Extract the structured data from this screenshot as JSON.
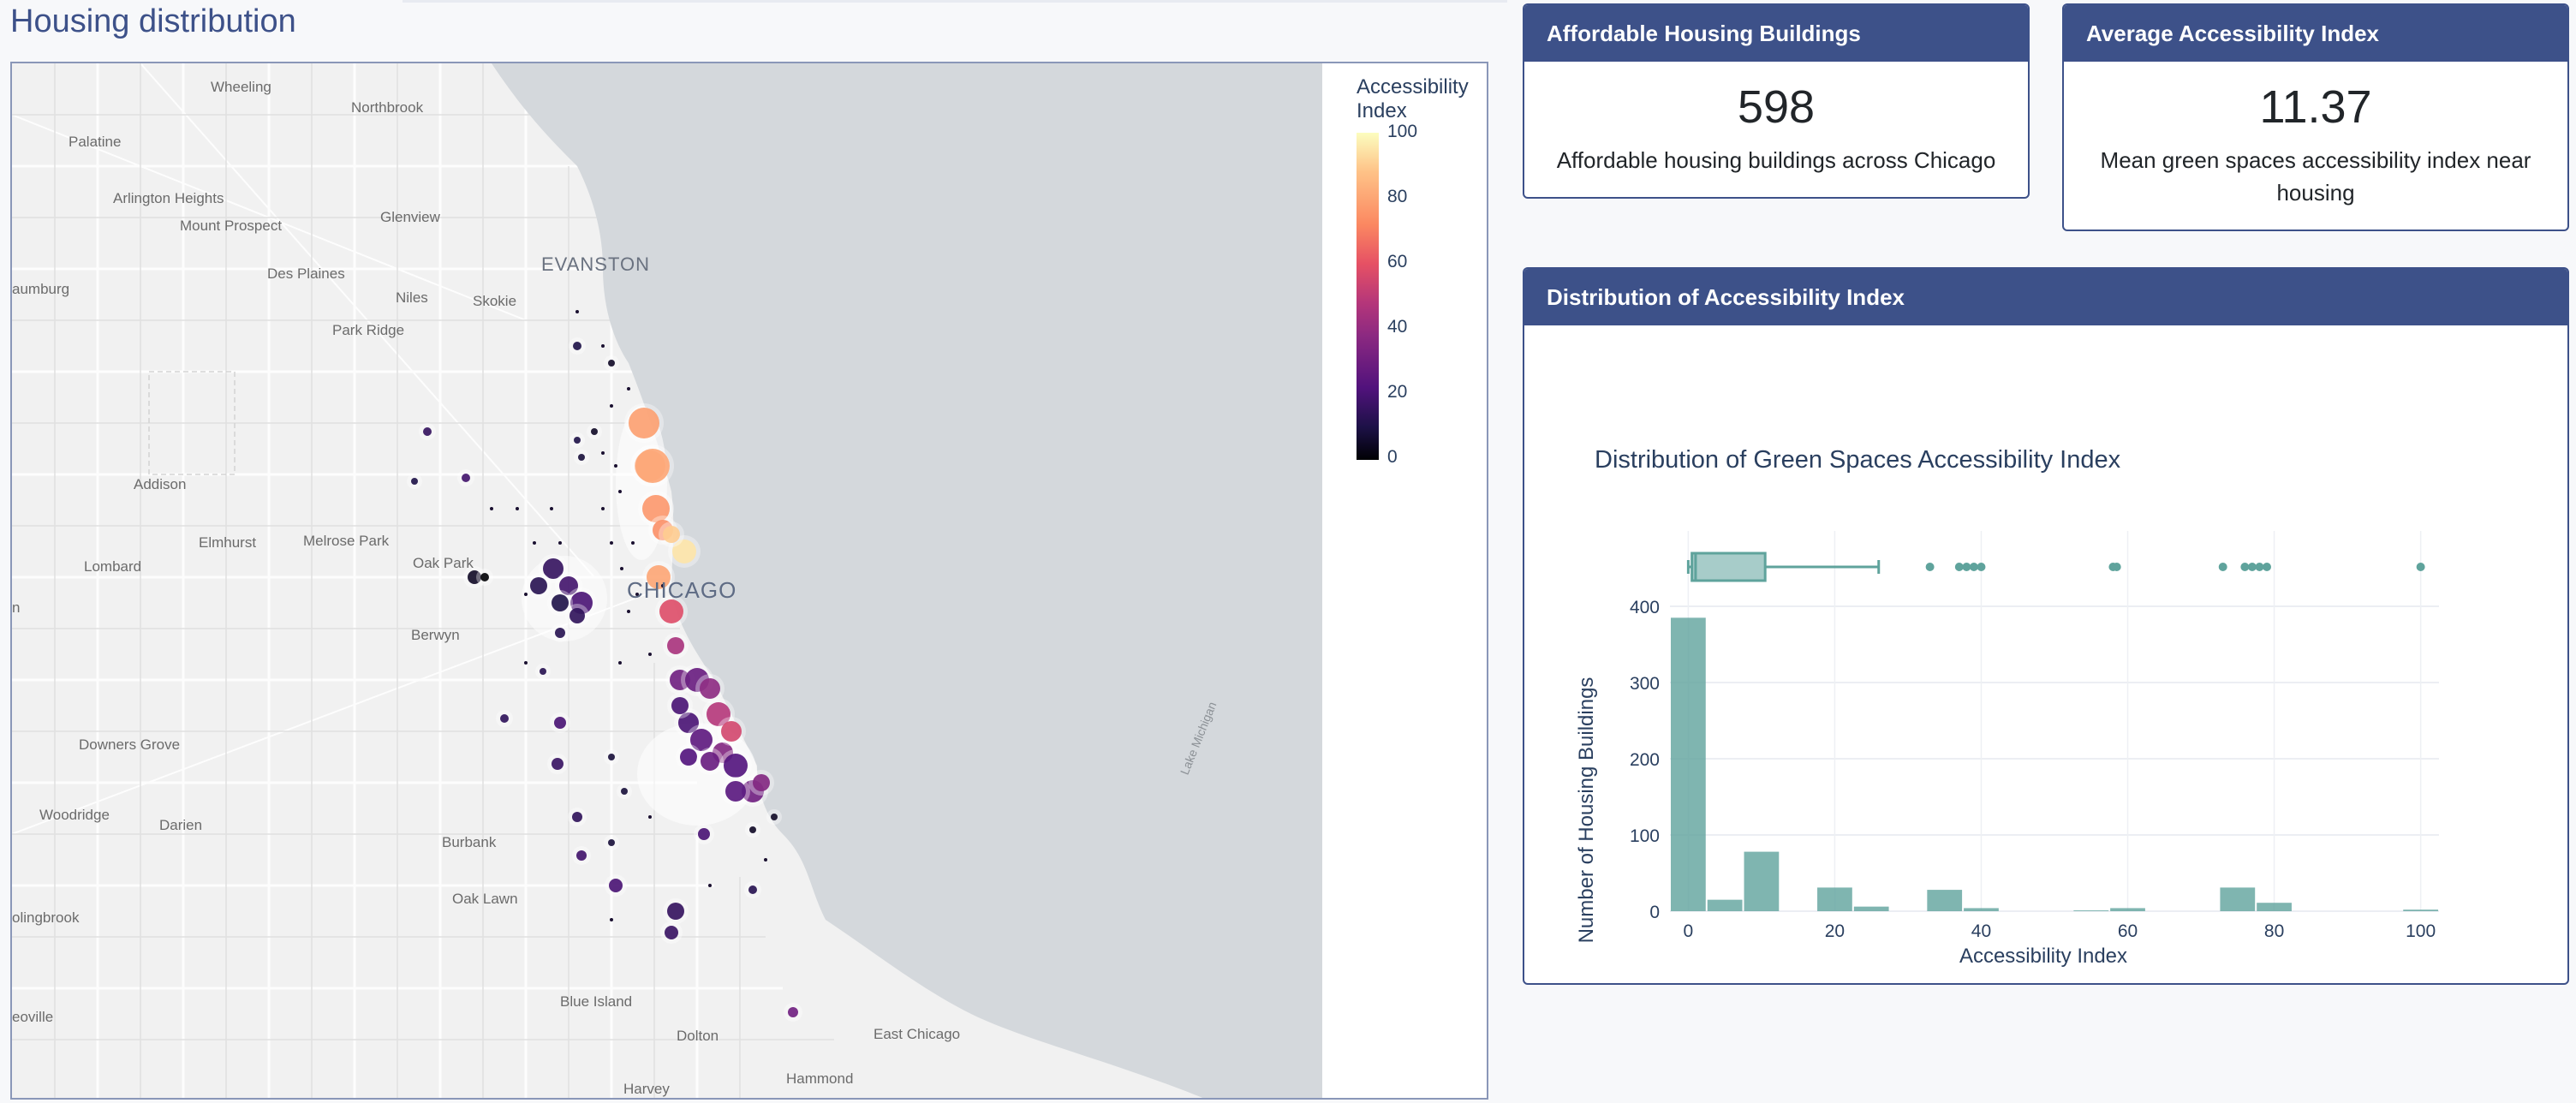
{
  "page": {
    "title": "Housing distribution"
  },
  "map": {
    "colorbar": {
      "title_line1": "Accessibility",
      "title_line2": "Index",
      "ticks": [
        "100",
        "80",
        "60",
        "40",
        "20",
        "0"
      ]
    },
    "labels": {
      "wheeling": "Wheeling",
      "northbrook": "Northbrook",
      "palatine": "Palatine",
      "arlington_heights": "Arlington Heights",
      "glenview": "Glenview",
      "mount_prospect": "Mount Prospect",
      "evanston": "EVANSTON",
      "schaumburg": "aumburg",
      "des_plaines": "Des Plaines",
      "niles": "Niles",
      "skokie": "Skokie",
      "park_ridge": "Park Ridge",
      "addison": "Addison",
      "elmhurst": "Elmhurst",
      "melrose_park": "Melrose Park",
      "lombard": "Lombard",
      "oak_park": "Oak Park",
      "chicago": "CHICAGO",
      "berwyn": "Berwyn",
      "edge_n": "n",
      "downers_grove": "Downers Grove",
      "woodridge": "Woodridge",
      "darien": "Darien",
      "burbank": "Burbank",
      "oak_lawn": "Oak Lawn",
      "bolingbrook": "olingbrook",
      "blue_island": "Blue Island",
      "romeoville": "eoville",
      "dolton": "Dolton",
      "east_chicago": "East Chicago",
      "hammond": "Hammond",
      "harvey": "Harvey",
      "lake_michigan": "Lake Michigan"
    }
  },
  "kpis": {
    "buildings": {
      "header": "Affordable Housing Buildings",
      "value": "598",
      "description": "Affordable housing buildings across Chicago"
    },
    "accessibility": {
      "header": "Average Accessibility Index",
      "value": "11.37",
      "description": "Mean green spaces accessibility index near housing"
    }
  },
  "distribution_card": {
    "header": "Distribution of Accessibility Index"
  },
  "chart_data": {
    "type": "bar",
    "title": "Distribution of Green Spaces Accessibility Index",
    "xlabel": "Accessibility Index",
    "ylabel": "Number of Housing Buildings",
    "xlim": [
      -2.5,
      102.5
    ],
    "ylim": [
      0,
      400
    ],
    "x_ticks": [
      0,
      20,
      40,
      60,
      80,
      100
    ],
    "y_ticks": [
      0,
      100,
      200,
      300,
      400
    ],
    "bin_width": 5,
    "bins": [
      {
        "x0": -2.5,
        "x1": 2.5,
        "count": 385
      },
      {
        "x0": 2.5,
        "x1": 7.5,
        "count": 15
      },
      {
        "x0": 7.5,
        "x1": 12.5,
        "count": 78
      },
      {
        "x0": 17.5,
        "x1": 22.5,
        "count": 31
      },
      {
        "x0": 22.5,
        "x1": 27.5,
        "count": 6
      },
      {
        "x0": 32.5,
        "x1": 37.5,
        "count": 28
      },
      {
        "x0": 37.5,
        "x1": 42.5,
        "count": 4
      },
      {
        "x0": 52.5,
        "x1": 57.5,
        "count": 1
      },
      {
        "x0": 57.5,
        "x1": 62.5,
        "count": 4
      },
      {
        "x0": 72.5,
        "x1": 77.5,
        "count": 31
      },
      {
        "x0": 77.5,
        "x1": 82.5,
        "count": 11
      },
      {
        "x0": 97.5,
        "x1": 102.5,
        "count": 2
      }
    ],
    "boxplot": {
      "min": 0,
      "q1": 0.5,
      "median": 1,
      "q3": 10.5,
      "upper_fence": 26,
      "outliers": [
        33,
        37,
        38,
        39,
        40,
        58,
        58.5,
        73,
        76,
        77,
        78,
        79,
        100
      ]
    },
    "color": "#5fa39c",
    "grid": true
  }
}
